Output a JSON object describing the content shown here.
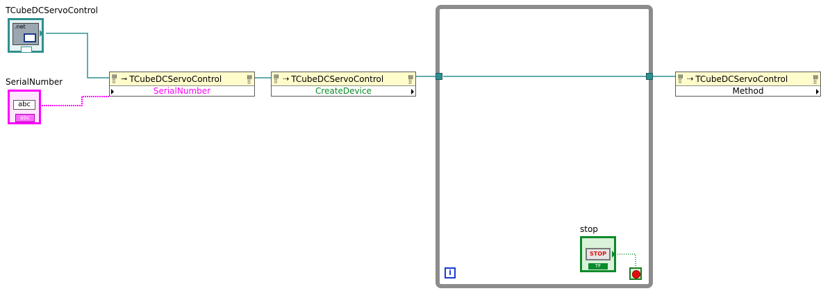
{
  "controls": {
    "tcube_label": "TCubeDCServoControl",
    "tcube_icon_text": ".net",
    "serial_label": "SerialNumber",
    "serial_icon_text": "abc",
    "serial_icon_sub": "abc",
    "stop_label": "stop",
    "stop_button_text": "STOP",
    "stop_sub_text": "TF"
  },
  "nodes": {
    "property": {
      "title": "TCubeDCServoControl",
      "item": "SerialNumber",
      "item_color": "#ff00ff"
    },
    "create": {
      "title": "TCubeDCServoControl",
      "item": "CreateDevice",
      "item_color": "#0a8a2a"
    },
    "method": {
      "title": "TCubeDCServoControl",
      "item": "Method",
      "item_color": "#000000"
    }
  },
  "loop": {
    "iteration_icon": "i",
    "stop_terminal_icon": "stop-condition-icon"
  },
  "colors": {
    "refnum_wire": "#2f8f8f",
    "string_wire": "#ff00ff",
    "boolean_wire": "#0a8a2a",
    "loop_frame": "#8c8c8c"
  }
}
